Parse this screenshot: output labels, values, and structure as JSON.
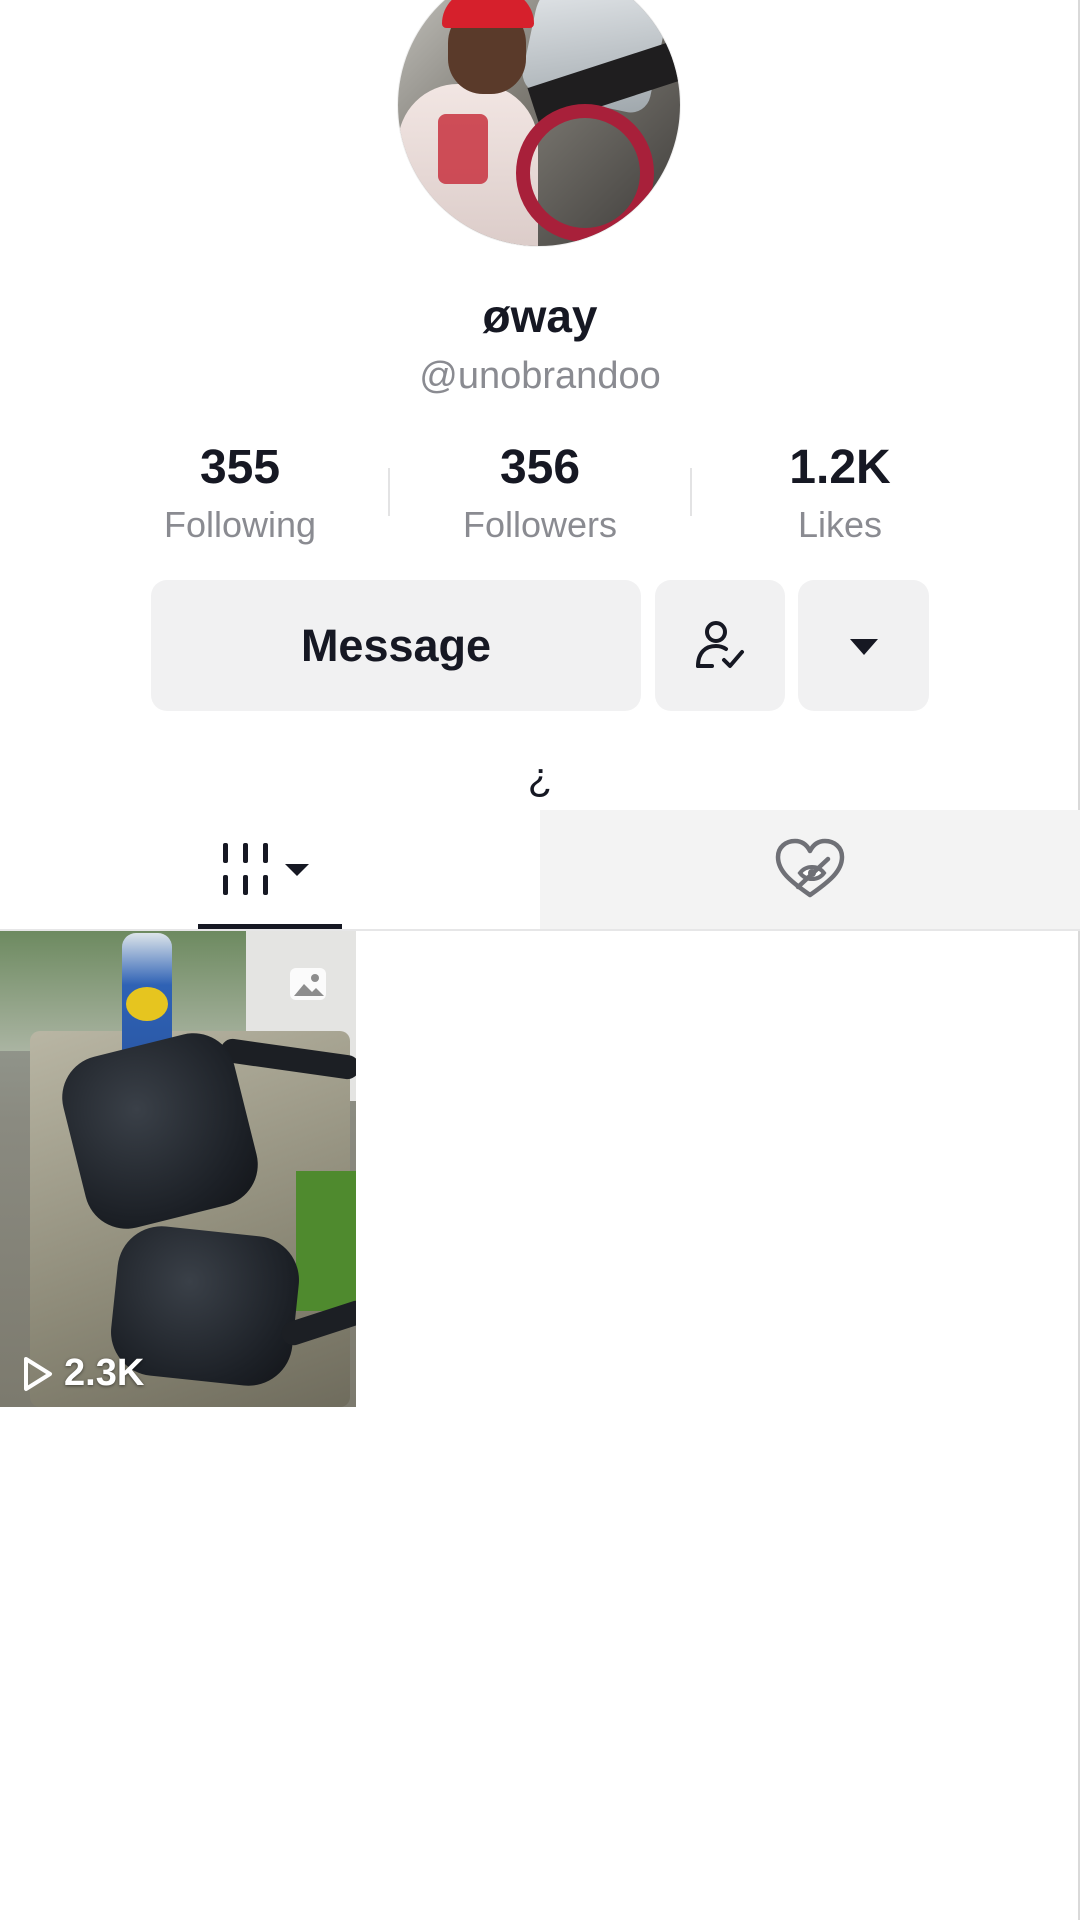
{
  "profile": {
    "display_name": "øway",
    "handle": "@unobrandoo",
    "bio": "¿"
  },
  "stats": [
    {
      "value": "355",
      "label": "Following"
    },
    {
      "value": "356",
      "label": "Followers"
    },
    {
      "value": "1.2K",
      "label": "Likes"
    }
  ],
  "actions": {
    "message_label": "Message",
    "following_icon": "person-check-icon",
    "more_icon": "caret-down-icon"
  },
  "tabs": [
    {
      "name": "videos",
      "icon": "grid-icon",
      "active": true
    },
    {
      "name": "liked",
      "icon": "hidden-heart-icon",
      "active": false
    }
  ],
  "videos": [
    {
      "views": "2.3K",
      "type_icon": "photo-icon"
    }
  ],
  "colors": {
    "text_primary": "#161823",
    "text_secondary": "#8a8b91",
    "button_bg": "#f1f1f2",
    "inactive_tab_bg": "#f3f3f3"
  }
}
